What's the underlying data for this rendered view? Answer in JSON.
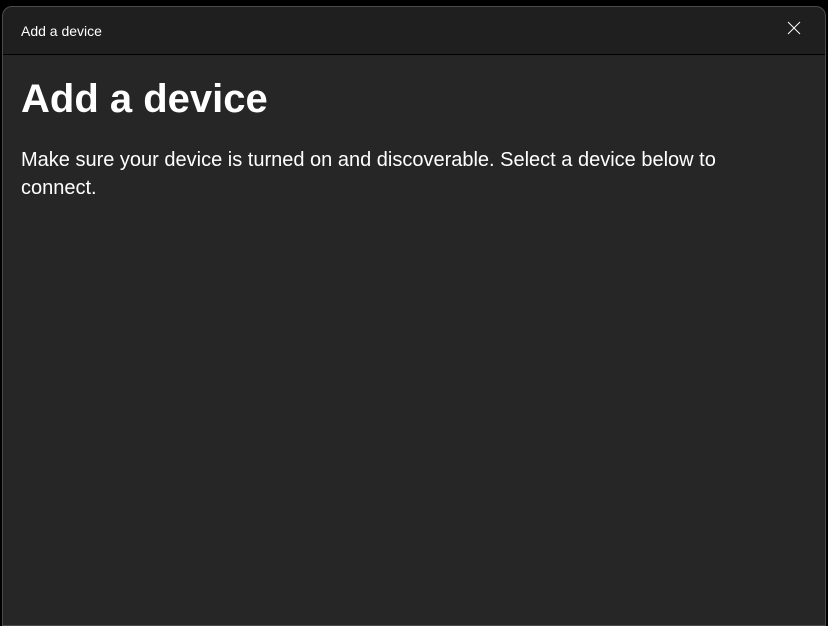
{
  "titlebar": {
    "title": "Add a device"
  },
  "content": {
    "heading": "Add a device",
    "description": "Make sure your device is turned on and discoverable. Select a device below to connect."
  }
}
